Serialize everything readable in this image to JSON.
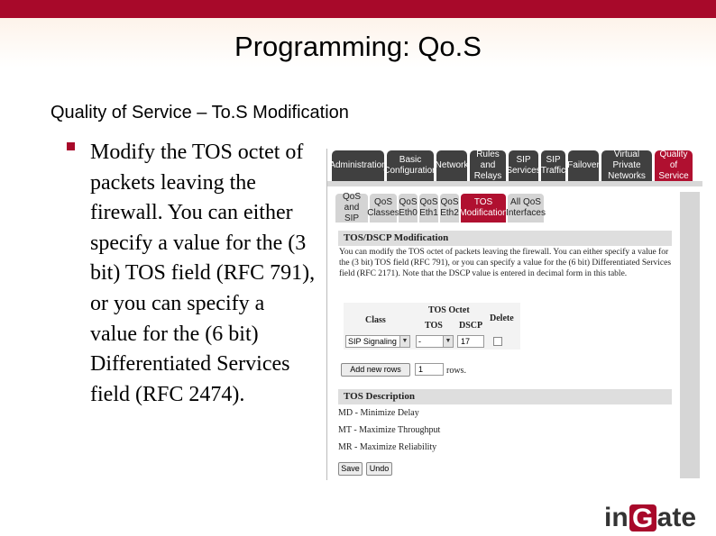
{
  "slide": {
    "title": "Programming: Qo.S",
    "subtitle": "Quality of Service – To.S Modification",
    "bullet": "Modify the TOS octet of packets leaving the firewall. You can either specify a value for the (3 bit) TOS field (RFC 791), or you can specify a value for the (6 bit) Differentiated Services field (RFC 2474).",
    "accent_color": "#a8092a"
  },
  "nav_tabs": [
    {
      "label": "Administration"
    },
    {
      "label": "Basic\nConfiguration"
    },
    {
      "label": "Network"
    },
    {
      "label": "Rules and\nRelays"
    },
    {
      "label": "SIP\nServices"
    },
    {
      "label": "SIP\nTraffic"
    },
    {
      "label": "Failover"
    },
    {
      "label": "Virtual Private\nNetworks"
    },
    {
      "label": "Quality of\nService",
      "active": true
    }
  ],
  "sub_tabs": [
    {
      "label": "QoS and\nSIP"
    },
    {
      "label": "QoS\nClasses"
    },
    {
      "label": "QoS\nEth0"
    },
    {
      "label": "QoS\nEth1"
    },
    {
      "label": "QoS\nEth2"
    },
    {
      "label": "TOS\nModification",
      "active": true
    },
    {
      "label": "All QoS\nInterfaces"
    }
  ],
  "tos_section": {
    "heading": "TOS/DSCP Modification",
    "intro": "You can modify the TOS octet of packets leaving the firewall. You can either specify a value for the (3 bit) TOS field (RFC 791), or you can specify a value for the (6 bit) Differentiated Services field (RFC 2171). Note that the DSCP value is entered in decimal form in this table."
  },
  "table": {
    "col_class": "Class",
    "col_tos_octet": "TOS Octet",
    "col_tos": "TOS",
    "col_dscp": "DSCP",
    "col_delete": "Delete",
    "row": {
      "class_value": "SIP Signaling",
      "tos_value": "-",
      "dscp_value": "17"
    }
  },
  "add_rows": {
    "button": "Add new rows",
    "count": "1",
    "suffix": "rows."
  },
  "desc_section": {
    "heading": "TOS Description",
    "items": [
      "MD - Minimize Delay",
      "MT - Maximize Throughput",
      "MR - Maximize Reliability"
    ]
  },
  "buttons": {
    "save": "Save",
    "undo": "Undo"
  },
  "logo": {
    "part1": "in",
    "part2": "G",
    "part3": "ate"
  }
}
